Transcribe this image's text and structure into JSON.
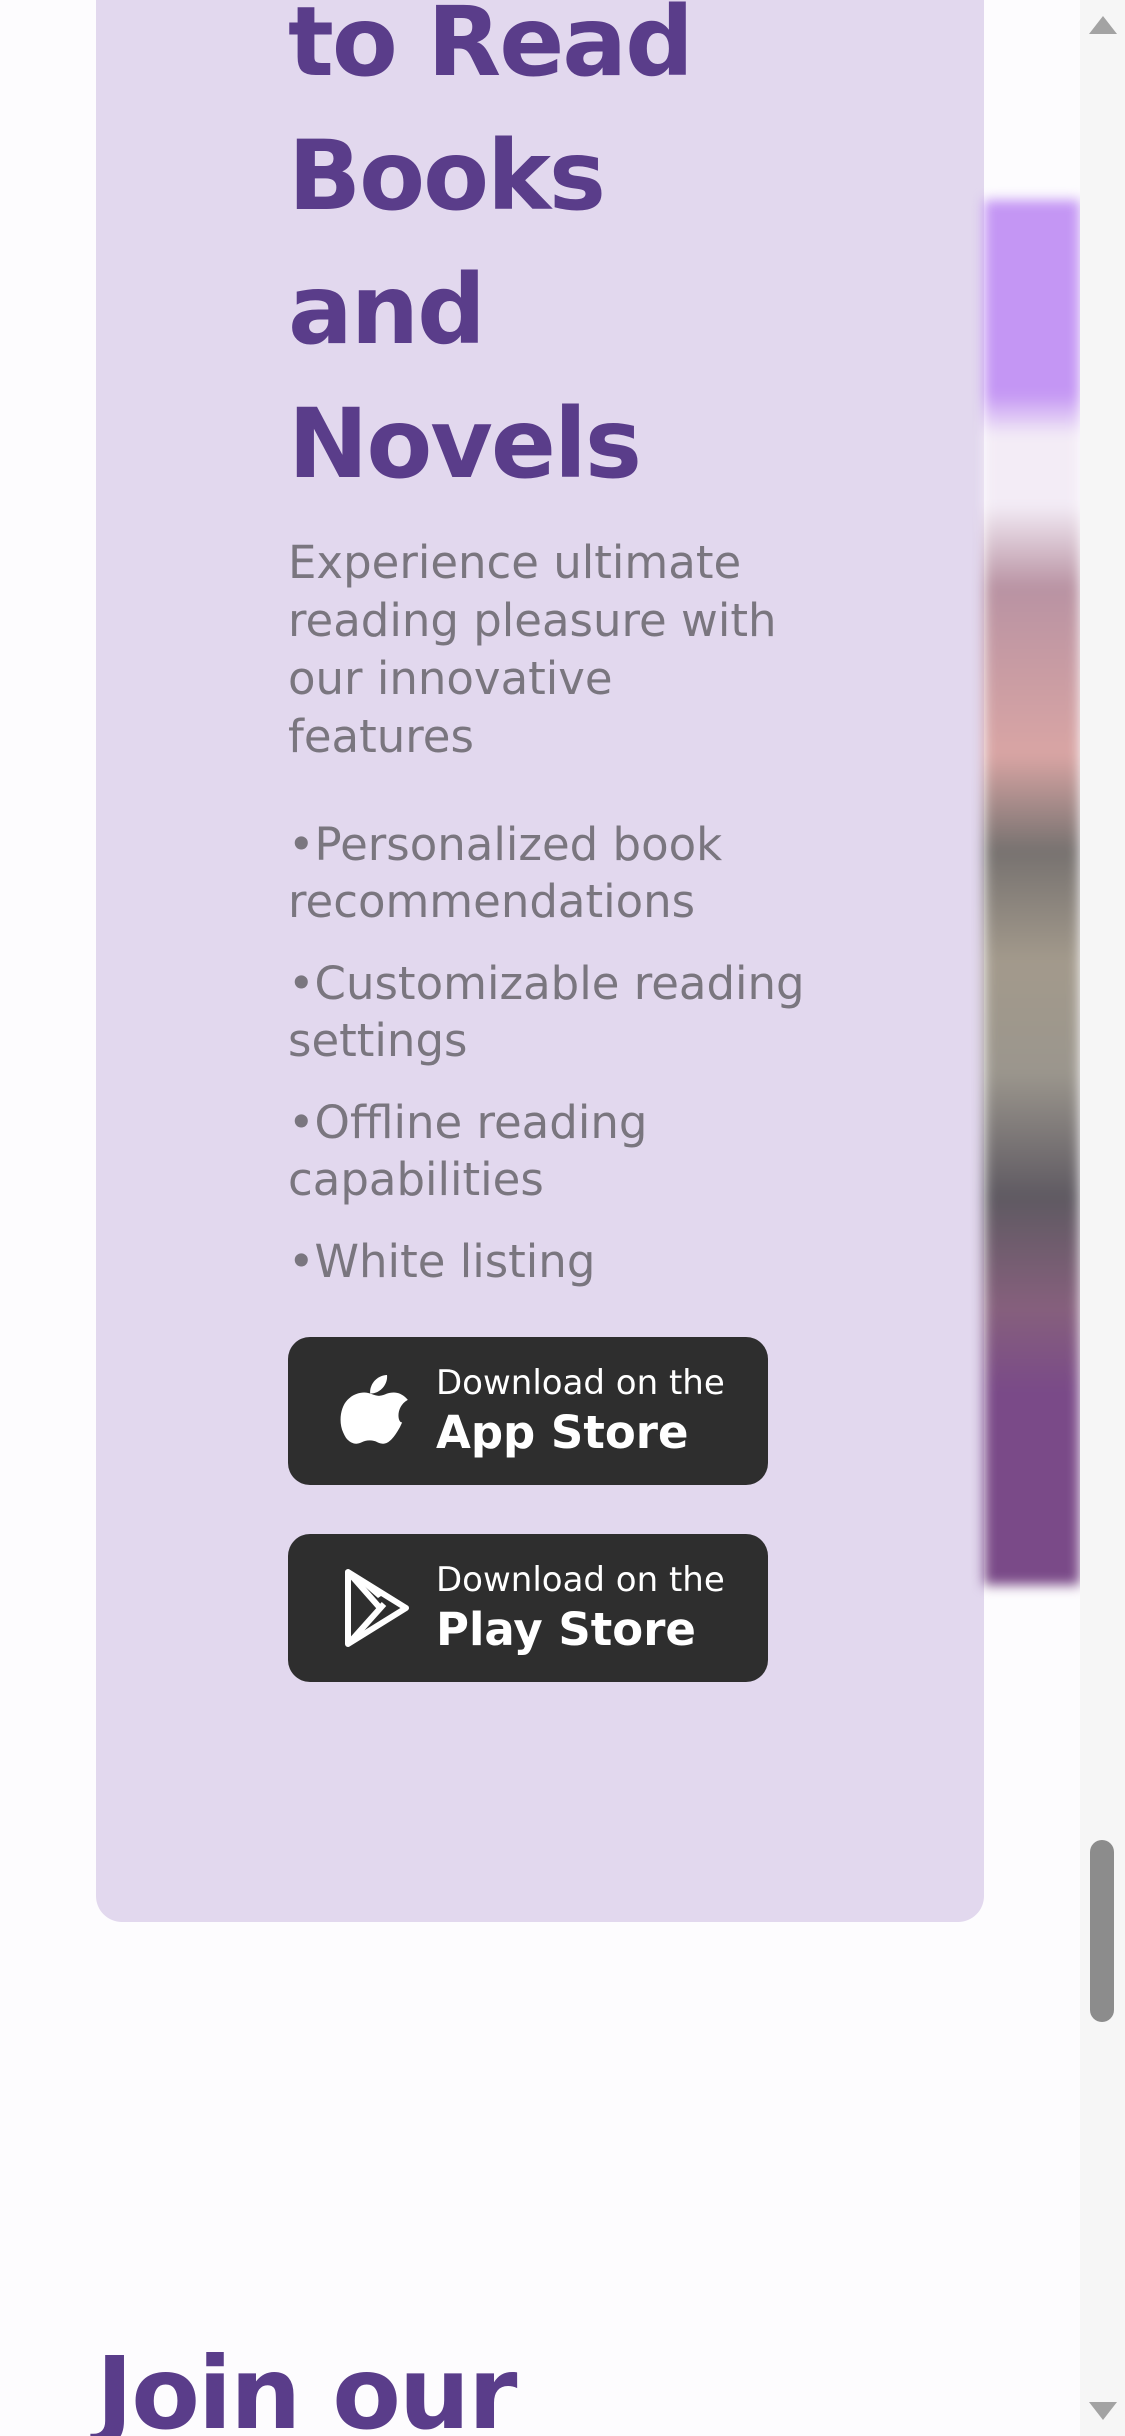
{
  "hero": {
    "title_lines": [
      "to Read",
      "Books",
      "and",
      "Novels"
    ],
    "subtitle": "Experience ultimate reading pleasure with our innovative features",
    "features": [
      "Personalized book recommendations",
      "Customizable reading settings",
      "Offline reading capabilities",
      "White listing"
    ],
    "app_store": {
      "small": "Download on the",
      "big": "App Store",
      "icon": "apple-icon"
    },
    "play_store": {
      "small": "Download on the",
      "big": "Play Store",
      "icon": "google-play-icon"
    },
    "card_color": "#e2d8ee",
    "title_color": "#5a3d8a",
    "button_color": "#2e2e2e"
  },
  "join": {
    "heading": "Join our"
  },
  "scrollbar": {
    "position_fraction": 0.86
  }
}
